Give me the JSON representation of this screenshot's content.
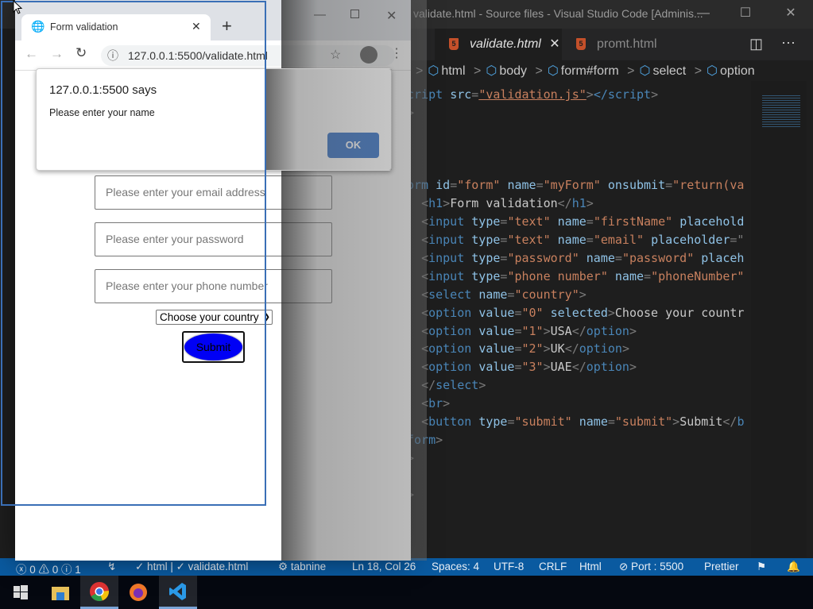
{
  "vscode": {
    "title": "validate.html - Source files - Visual Studio Code [Adminis...",
    "tabs": [
      {
        "label": "validate.html",
        "active": true
      },
      {
        "label": "promt.html",
        "active": false
      }
    ],
    "breadcrumbs": [
      "html",
      "body",
      "form#form",
      "select",
      "option"
    ],
    "code": [
      [
        [
          "tg",
          "cript "
        ],
        [
          "at",
          "src"
        ],
        [
          "pu",
          "="
        ],
        [
          "st u",
          "\"validation.js\""
        ],
        [
          "pu",
          ">"
        ],
        [
          "tg",
          "</script"
        ],
        [
          "pu",
          ">"
        ]
      ],
      [
        [
          "pu",
          ">"
        ]
      ],
      [],
      [],
      [],
      [
        [
          "tg",
          "orm "
        ],
        [
          "at",
          "id"
        ],
        [
          "pu",
          "="
        ],
        [
          "st",
          "\"form\" "
        ],
        [
          "at",
          "name"
        ],
        [
          "pu",
          "="
        ],
        [
          "st",
          "\"myForm\" "
        ],
        [
          "at",
          "onsubmit"
        ],
        [
          "pu",
          "="
        ],
        [
          "st",
          "\"return(va"
        ]
      ],
      [
        [
          "tx",
          "  "
        ],
        [
          "pu",
          "<"
        ],
        [
          "tg",
          "h1"
        ],
        [
          "pu",
          ">"
        ],
        [
          "tx",
          "Form validation"
        ],
        [
          "pu",
          "</"
        ],
        [
          "tg",
          "h1"
        ],
        [
          "pu",
          ">"
        ]
      ],
      [
        [
          "tx",
          "  "
        ],
        [
          "pu",
          "<"
        ],
        [
          "tg",
          "input "
        ],
        [
          "at",
          "type"
        ],
        [
          "pu",
          "="
        ],
        [
          "st",
          "\"text\" "
        ],
        [
          "at",
          "name"
        ],
        [
          "pu",
          "="
        ],
        [
          "st",
          "\"firstName\" "
        ],
        [
          "at",
          "placehold"
        ]
      ],
      [
        [
          "tx",
          "  "
        ],
        [
          "pu",
          "<"
        ],
        [
          "tg",
          "input "
        ],
        [
          "at",
          "type"
        ],
        [
          "pu",
          "="
        ],
        [
          "st",
          "\"text\" "
        ],
        [
          "at",
          "name"
        ],
        [
          "pu",
          "="
        ],
        [
          "st",
          "\"email\" "
        ],
        [
          "at",
          "placeholder"
        ],
        [
          "pu",
          "=\""
        ]
      ],
      [
        [
          "tx",
          "  "
        ],
        [
          "pu",
          "<"
        ],
        [
          "tg",
          "input "
        ],
        [
          "at",
          "type"
        ],
        [
          "pu",
          "="
        ],
        [
          "st",
          "\"password\" "
        ],
        [
          "at",
          "name"
        ],
        [
          "pu",
          "="
        ],
        [
          "st",
          "\"password\" "
        ],
        [
          "at",
          "placeh"
        ]
      ],
      [
        [
          "tx",
          "  "
        ],
        [
          "pu",
          "<"
        ],
        [
          "tg",
          "input "
        ],
        [
          "at",
          "type"
        ],
        [
          "pu",
          "="
        ],
        [
          "st",
          "\"phone number\" "
        ],
        [
          "at",
          "name"
        ],
        [
          "pu",
          "="
        ],
        [
          "st",
          "\"phoneNumber\""
        ]
      ],
      [
        [
          "tx",
          "  "
        ],
        [
          "pu",
          "<"
        ],
        [
          "tg",
          "select "
        ],
        [
          "at",
          "name"
        ],
        [
          "pu",
          "="
        ],
        [
          "st",
          "\"country\""
        ],
        [
          "pu",
          ">"
        ]
      ],
      [
        [
          "tx",
          "  "
        ],
        [
          "pu",
          "<"
        ],
        [
          "tg",
          "option "
        ],
        [
          "at",
          "value"
        ],
        [
          "pu",
          "="
        ],
        [
          "st",
          "\"0\" "
        ],
        [
          "at",
          "selected"
        ],
        [
          "pu",
          ">"
        ],
        [
          "tx",
          "Choose your countr"
        ]
      ],
      [
        [
          "tx",
          "  "
        ],
        [
          "pu",
          "<"
        ],
        [
          "tg",
          "option "
        ],
        [
          "at",
          "value"
        ],
        [
          "pu",
          "="
        ],
        [
          "st",
          "\"1\""
        ],
        [
          "pu",
          ">"
        ],
        [
          "tx",
          "USA"
        ],
        [
          "pu",
          "</"
        ],
        [
          "tg",
          "option"
        ],
        [
          "pu",
          ">"
        ]
      ],
      [
        [
          "tx",
          "  "
        ],
        [
          "pu",
          "<"
        ],
        [
          "tg",
          "option "
        ],
        [
          "at",
          "value"
        ],
        [
          "pu",
          "="
        ],
        [
          "st",
          "\"2\""
        ],
        [
          "pu",
          ">"
        ],
        [
          "tx",
          "UK"
        ],
        [
          "pu",
          "</"
        ],
        [
          "tg",
          "option"
        ],
        [
          "pu",
          ">"
        ]
      ],
      [
        [
          "tx",
          "  "
        ],
        [
          "pu",
          "<"
        ],
        [
          "tg",
          "option "
        ],
        [
          "at",
          "value"
        ],
        [
          "pu",
          "="
        ],
        [
          "st",
          "\"3\""
        ],
        [
          "pu",
          ">"
        ],
        [
          "tx",
          "UAE"
        ],
        [
          "pu",
          "</"
        ],
        [
          "tg",
          "option"
        ],
        [
          "pu",
          ">"
        ]
      ],
      [
        [
          "tx",
          "  "
        ],
        [
          "pu",
          "</"
        ],
        [
          "tg",
          "select"
        ],
        [
          "pu",
          ">"
        ]
      ],
      [
        [
          "tx",
          "  "
        ],
        [
          "pu",
          "<"
        ],
        [
          "tg",
          "br"
        ],
        [
          "pu",
          ">"
        ]
      ],
      [
        [
          "tx",
          "  "
        ],
        [
          "pu",
          "<"
        ],
        [
          "tg",
          "button "
        ],
        [
          "at",
          "type"
        ],
        [
          "pu",
          "="
        ],
        [
          "st",
          "\"submit\" "
        ],
        [
          "at",
          "name"
        ],
        [
          "pu",
          "="
        ],
        [
          "st",
          "\"submit\""
        ],
        [
          "pu",
          ">"
        ],
        [
          "tx",
          "Submit"
        ],
        [
          "pu",
          "</"
        ],
        [
          "tg",
          "b"
        ]
      ],
      [
        [
          "tg",
          "form"
        ],
        [
          "pu",
          ">"
        ]
      ],
      [
        [
          "pu",
          ">"
        ]
      ],
      [],
      [
        [
          "pu",
          ">"
        ]
      ]
    ],
    "status": {
      "problems": "ⓧ 0 ⚠ 0 ⓘ 1",
      "html_check": "✓ html | ✓ validate.html",
      "tabnine": "⚙ tabnine",
      "position": "Ln 18, Col 26",
      "spaces": "Spaces: 4",
      "encoding": "UTF-8",
      "eol": "CRLF",
      "language": "Html",
      "port": "⊘ Port : 5500",
      "prettier": "Prettier"
    }
  },
  "browser": {
    "tab_title": "Form validation",
    "url": "127.0.0.1:5500/validate.html",
    "page": {
      "email_placeholder": "Please enter your email address",
      "password_placeholder": "Please enter your password",
      "phone_placeholder": "Please enter your phone number",
      "country_selected": "Choose your country",
      "submit_label": "Submit"
    },
    "dialog": {
      "title": "127.0.0.1:5500 says",
      "message": "Please enter your name",
      "ok_label": "OK"
    }
  },
  "colors": {
    "statusbar": "#0a5aa0",
    "submit": "#0000f5",
    "ok": "#2f6dc4"
  }
}
